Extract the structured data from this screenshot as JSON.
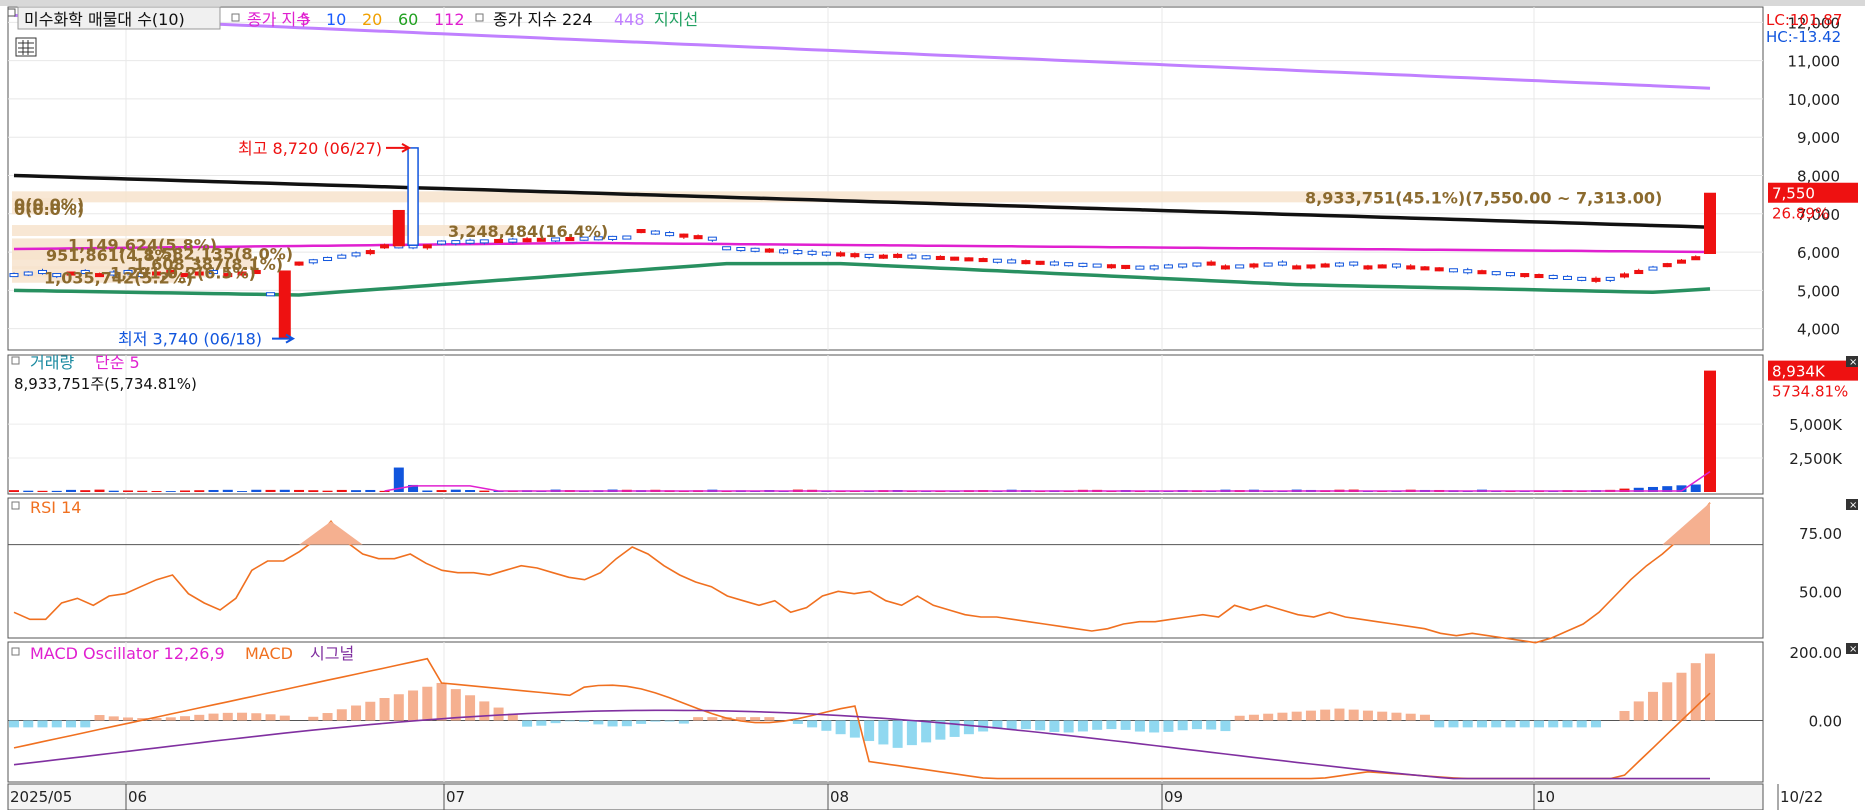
{
  "symbol_label": "미수화학 매물대 수(10)",
  "legend_price": {
    "title": "종가 지수",
    "ma_short": [
      {
        "label": "5",
        "color": "#e020d0"
      },
      {
        "label": "10",
        "color": "#1a5cff"
      },
      {
        "label": "20",
        "color": "#f0a000"
      },
      {
        "label": "60",
        "color": "#20a020"
      },
      {
        "label": "112",
        "color": "#e020d0"
      }
    ],
    "title2": "종가 지수 224",
    "ma_long": {
      "label": "448",
      "color": "#c080ff"
    },
    "support": {
      "label": "지지선",
      "color": "#20a060"
    }
  },
  "lc_label": "LC:101.87",
  "hc_label": "HC:-13.42",
  "price_axis": [
    "12,000",
    "11,000",
    "10,000",
    "9,000",
    "8,000",
    "7,000",
    "6,000",
    "5,000",
    "4,000"
  ],
  "current_price": "7,550",
  "current_change": "26.89%",
  "high_marker": "최고 8,720 (06/27)",
  "low_marker": "최저 3,740 (06/18)",
  "volume_profile": [
    {
      "label": "8,933,751(45.1%)(7,550.00 ~ 7,313.00)",
      "price": 7430,
      "w": 1360
    },
    {
      "label": "0(0.0%)",
      "price": 7250,
      "w": 40
    },
    {
      "label": "0(0.0%)",
      "price": 7120,
      "w": 40
    },
    {
      "label": "3,248,484(16.4%)",
      "price": 6550,
      "w": 500
    },
    {
      "label": "1,149,624(5.8%)",
      "price": 6200,
      "w": 175
    },
    {
      "label": "951,861(4.8%)",
      "price": 5930,
      "w": 150
    },
    {
      "label": "1,582,135(8.0%)",
      "price": 5960,
      "w": 240
    },
    {
      "label": "1,608,387(8.1%)",
      "price": 5690,
      "w": 245
    },
    {
      "label": "1,291,0_2(6.5%)",
      "price": 5470,
      "w": 200
    },
    {
      "label": "1,035,742(5.2%)",
      "price": 5330,
      "w": 165
    }
  ],
  "volume_panel": {
    "title": "거래량",
    "ma_label": "단순 5",
    "info": "8,933,751주(5,734.81%)",
    "axis": [
      "5,000K",
      "2,500K"
    ],
    "current": "8,934K",
    "current_change": "5734.81%"
  },
  "rsi_panel": {
    "title": "RSI 14",
    "axis": [
      "75.00",
      "50.00"
    ]
  },
  "macd_panel": {
    "title": "MACD Oscillator 12,26,9",
    "macd_label": "MACD",
    "signal_label": "시그널",
    "axis": [
      "200.00",
      "0.00"
    ]
  },
  "date_axis": [
    "2025/05",
    "06",
    "07",
    "08",
    "09",
    "10",
    "10/22"
  ],
  "colors": {
    "up": "#ee1111",
    "down": "#1155dd",
    "ma224": "#111111",
    "ma448": "#c080ff",
    "ma112": "#e020d0",
    "support": "#289060",
    "rsi": "#f07020",
    "macd": "#f07020",
    "signal": "#8030a0",
    "osc_pos": "#f5b090",
    "osc_neg": "#90d8f0"
  },
  "chart_data": {
    "type": "candlestick",
    "x_range": [
      "2025/05",
      "10/22"
    ],
    "price_ylim": [
      3600,
      12400
    ],
    "price_high": {
      "value": 8720,
      "date": "06/27"
    },
    "price_low": {
      "value": 3740,
      "date": "06/18"
    },
    "last_candle": {
      "open": 5950,
      "close": 7550,
      "high": 7550,
      "low": 5950
    },
    "volume_last": 8934,
    "rsi_ylim": [
      30,
      90
    ],
    "macd_ylim": [
      -180,
      230
    ]
  }
}
